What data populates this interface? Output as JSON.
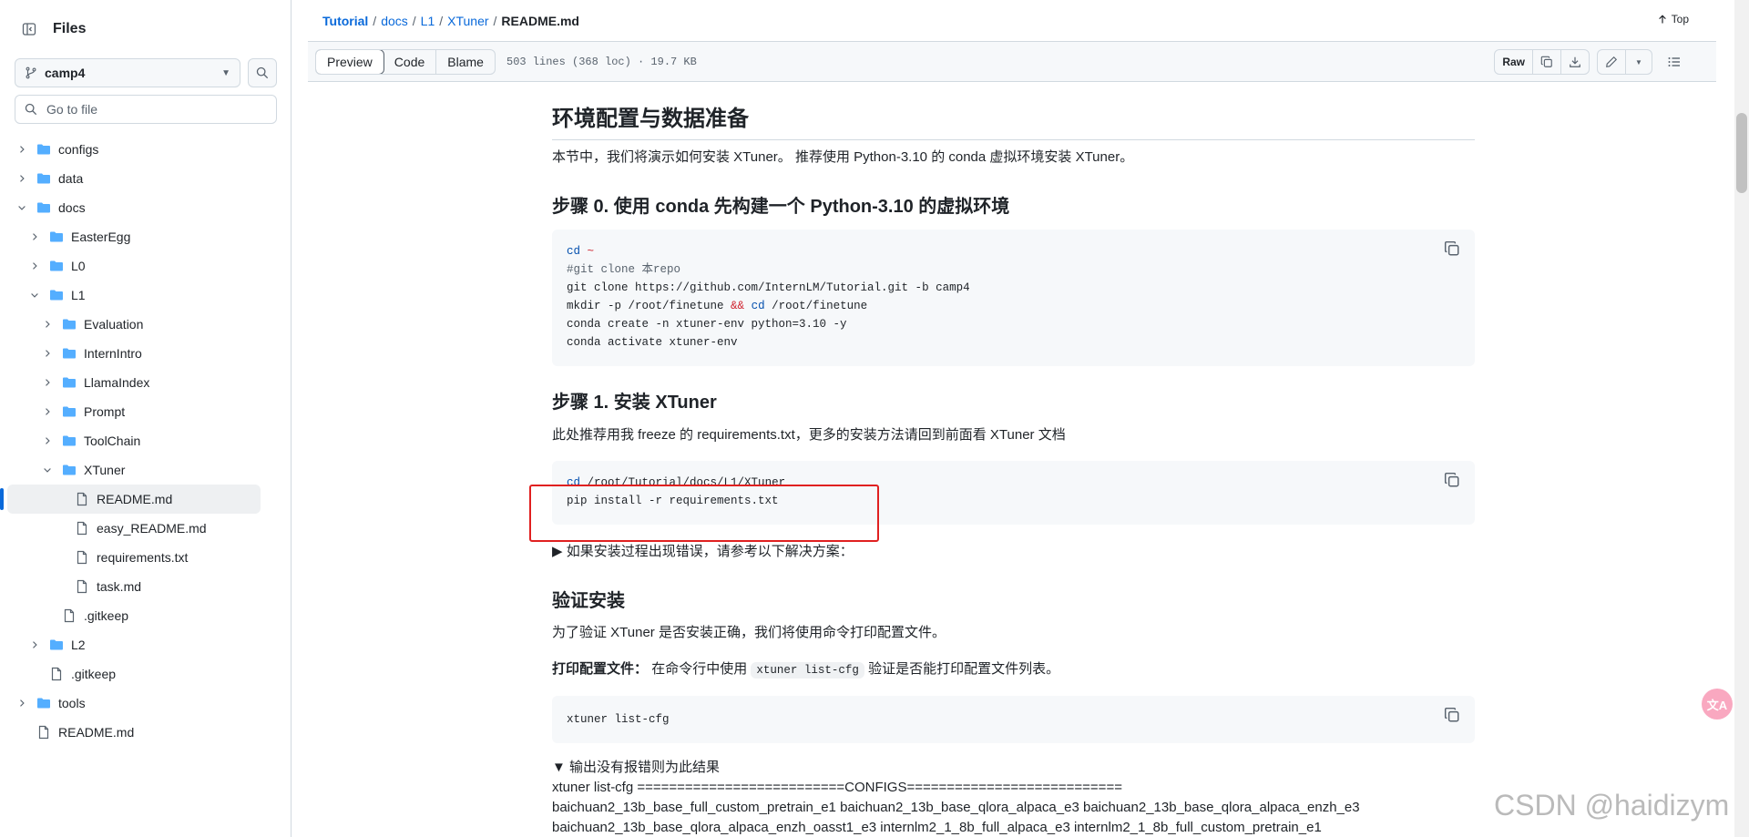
{
  "sidebar": {
    "title": "Files",
    "branch": "camp4",
    "goto_placeholder": "Go to file",
    "tree": [
      {
        "label": "configs",
        "type": "folder",
        "depth": 0,
        "state": "collapsed"
      },
      {
        "label": "data",
        "type": "folder",
        "depth": 0,
        "state": "collapsed"
      },
      {
        "label": "docs",
        "type": "folder",
        "depth": 0,
        "state": "expanded"
      },
      {
        "label": "EasterEgg",
        "type": "folder",
        "depth": 1,
        "state": "collapsed"
      },
      {
        "label": "L0",
        "type": "folder",
        "depth": 1,
        "state": "collapsed"
      },
      {
        "label": "L1",
        "type": "folder",
        "depth": 1,
        "state": "expanded"
      },
      {
        "label": "Evaluation",
        "type": "folder",
        "depth": 2,
        "state": "collapsed"
      },
      {
        "label": "InternIntro",
        "type": "folder",
        "depth": 2,
        "state": "collapsed"
      },
      {
        "label": "LlamaIndex",
        "type": "folder",
        "depth": 2,
        "state": "collapsed"
      },
      {
        "label": "Prompt",
        "type": "folder",
        "depth": 2,
        "state": "collapsed"
      },
      {
        "label": "ToolChain",
        "type": "folder",
        "depth": 2,
        "state": "collapsed"
      },
      {
        "label": "XTuner",
        "type": "folder",
        "depth": 2,
        "state": "expanded"
      },
      {
        "label": "README.md",
        "type": "file",
        "depth": 3,
        "active": true
      },
      {
        "label": "easy_README.md",
        "type": "file",
        "depth": 3
      },
      {
        "label": "requirements.txt",
        "type": "file",
        "depth": 3
      },
      {
        "label": "task.md",
        "type": "file",
        "depth": 3
      },
      {
        "label": ".gitkeep",
        "type": "file",
        "depth": 2
      },
      {
        "label": "L2",
        "type": "folder",
        "depth": 1,
        "state": "collapsed"
      },
      {
        "label": ".gitkeep",
        "type": "file",
        "depth": 1
      },
      {
        "label": "tools",
        "type": "folder",
        "depth": 0,
        "state": "collapsed"
      },
      {
        "label": "README.md",
        "type": "file",
        "depth": 0
      }
    ]
  },
  "breadcrumb": {
    "items": [
      "Tutorial",
      "docs",
      "L1",
      "XTuner"
    ],
    "current": "README.md",
    "top_label": "Top"
  },
  "filebar": {
    "tabs": [
      "Preview",
      "Code",
      "Blame"
    ],
    "active_tab": "Preview",
    "info": "503 lines (368 loc) · 19.7 KB",
    "raw_label": "Raw"
  },
  "readme": {
    "h_env": "环境配置与数据准备",
    "p_intro": "本节中，我们将演示如何安装 XTuner。 推荐使用 Python-3.10 的 conda 虚拟环境安装 XTuner。",
    "h_step0": "步骤 0. 使用 conda 先构建一个 Python-3.10 的虚拟环境",
    "code0": {
      "l1_kw": "cd",
      "l1_op": "~",
      "l2": "#git clone 本repo",
      "l3": "git clone https://github.com/InternLM/Tutorial.git -b camp4",
      "l4_a": "mkdir -p /root/finetune",
      "l4_op": "&&",
      "l4_kw": "cd",
      "l4_b": "/root/finetune",
      "l5": "conda create -n xtuner-env python=3.10 -y",
      "l6": "conda activate xtuner-env"
    },
    "h_step1": "步骤 1. 安装 XTuner",
    "p_step1": "此处推荐用我 freeze 的 requirements.txt，更多的安装方法请回到前面看 XTuner 文档",
    "code1": {
      "l1_kw": "cd",
      "l1": "/root/Tutorial/docs/L1/XTuner",
      "l2": "pip install -r requirements.txt"
    },
    "details1": "▶ 如果安装过程出现错误，请参考以下解决方案：",
    "h_verify": "验证安装",
    "p_verify": "为了验证 XTuner 是否安装正确，我们将使用命令打印配置文件。",
    "p_print_bold": "打印配置文件：",
    "p_print_a": "在命令行中使用",
    "p_print_code": "xtuner list-cfg",
    "p_print_b": "验证是否能打印配置文件列表。",
    "code2": "xtuner list-cfg",
    "details2": "▼ 输出没有报错则为此结果",
    "out1": "xtuner list-cfg ==========================CONFIGS===========================",
    "out2": "baichuan2_13b_base_full_custom_pretrain_e1 baichuan2_13b_base_qlora_alpaca_e3 baichuan2_13b_base_qlora_alpaca_enzh_e3",
    "out3": "baichuan2_13b_base_qlora_alpaca_enzh_oasst1_e3    internlm2_1_8b_full_alpaca_e3 internlm2_1_8b_full_custom_pretrain_e1"
  },
  "translate_badge": "文A",
  "watermark": "CSDN @haidizym"
}
